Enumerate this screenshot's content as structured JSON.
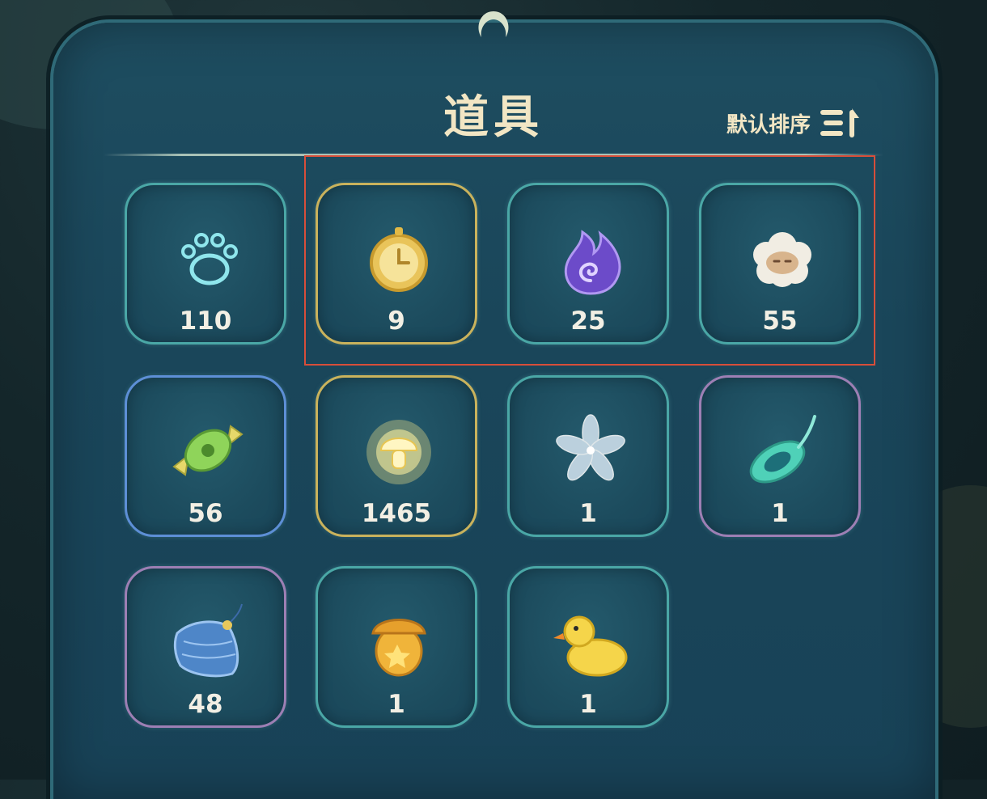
{
  "title": "道具",
  "sort_label": "默认排序",
  "colors": {
    "accent_text": "#f2e6c4",
    "highlight_box": "#d84e3a",
    "panel": "#1b485c"
  },
  "items": [
    {
      "icon": "paw-icon",
      "count": "110"
    },
    {
      "icon": "gold-stopwatch-icon",
      "count": "9"
    },
    {
      "icon": "purple-flame-icon",
      "count": "25"
    },
    {
      "icon": "sheep-icon",
      "count": "55"
    },
    {
      "icon": "green-candy-icon",
      "count": "56"
    },
    {
      "icon": "glowing-mushroom-icon",
      "count": "1465"
    },
    {
      "icon": "crystal-flower-icon",
      "count": "1"
    },
    {
      "icon": "teal-feather-icon",
      "count": "1"
    },
    {
      "icon": "blue-cloth-bag-icon",
      "count": "48"
    },
    {
      "icon": "star-acorn-icon",
      "count": "1"
    },
    {
      "icon": "rubber-duck-icon",
      "count": "1"
    }
  ]
}
